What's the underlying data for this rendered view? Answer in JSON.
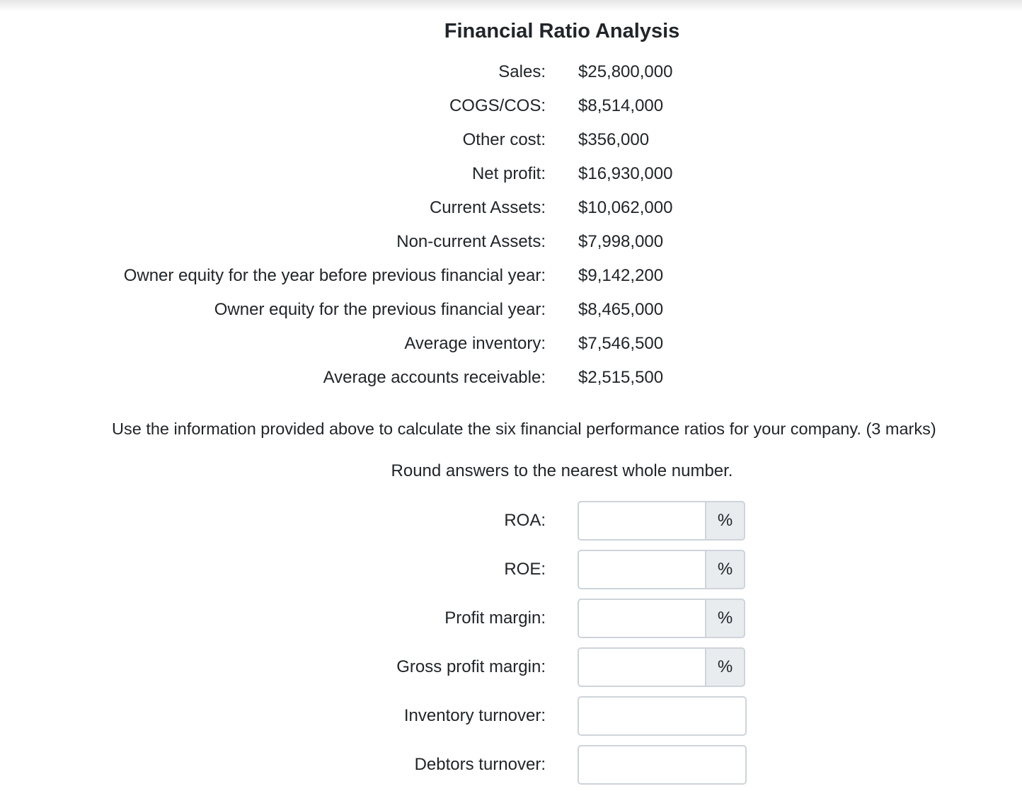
{
  "title": "Financial Ratio Analysis",
  "financials": [
    {
      "label": "Sales:",
      "value": "$25,800,000"
    },
    {
      "label": "COGS/COS:",
      "value": "$8,514,000"
    },
    {
      "label": "Other cost:",
      "value": "$356,000"
    },
    {
      "label": "Net profit:",
      "value": "$16,930,000"
    },
    {
      "label": "Current Assets:",
      "value": "$10,062,000"
    },
    {
      "label": "Non-current Assets:",
      "value": "$7,998,000"
    },
    {
      "label": "Owner equity for the year before previous financial year:",
      "value": "$9,142,200"
    },
    {
      "label": "Owner equity for the previous financial year:",
      "value": "$8,465,000"
    },
    {
      "label": "Average inventory:",
      "value": "$7,546,500"
    },
    {
      "label": "Average accounts receivable:",
      "value": "$2,515,500"
    }
  ],
  "instruction": "Use the information provided above to calculate the six financial performance ratios for your company. (3 marks)",
  "round_note": "Round answers to the nearest whole number.",
  "ratios": [
    {
      "label": "ROA:",
      "value": "",
      "unit": "%"
    },
    {
      "label": "ROE:",
      "value": "",
      "unit": "%"
    },
    {
      "label": "Profit margin:",
      "value": "",
      "unit": "%"
    },
    {
      "label": "Gross profit margin:",
      "value": "",
      "unit": "%"
    },
    {
      "label": "Inventory turnover:",
      "value": ""
    },
    {
      "label": "Debtors turnover:",
      "value": ""
    }
  ]
}
